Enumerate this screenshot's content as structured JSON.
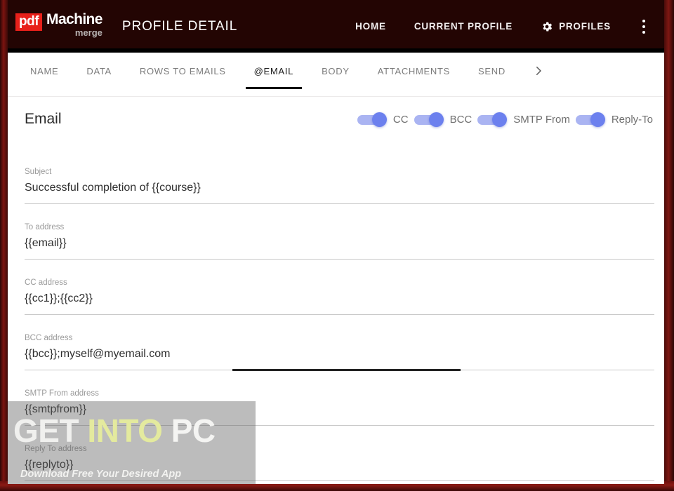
{
  "brand": {
    "logo_badge": "pdf",
    "logo_word": "Machine",
    "logo_sub": "merge",
    "accent_red": "#e8201a",
    "topbar_bg": "#230503"
  },
  "header": {
    "page_title": "PROFILE DETAIL",
    "nav": [
      {
        "label": "HOME",
        "icon": null
      },
      {
        "label": "CURRENT PROFILE",
        "icon": null
      },
      {
        "label": "PROFILES",
        "icon": "gear-icon"
      }
    ],
    "overflow_icon": "kebab-menu-icon"
  },
  "tabs": {
    "items": [
      {
        "label": "NAME",
        "active": false
      },
      {
        "label": "DATA",
        "active": false
      },
      {
        "label": "ROWS TO EMAILS",
        "active": false
      },
      {
        "label": "@EMAIL",
        "active": true
      },
      {
        "label": "BODY",
        "active": false
      },
      {
        "label": "ATTACHMENTS",
        "active": false
      },
      {
        "label": "SEND",
        "active": false
      }
    ],
    "more_icon": "chevron-right-icon"
  },
  "section": {
    "title": "Email",
    "toggles": [
      {
        "label": "CC",
        "on": true
      },
      {
        "label": "BCC",
        "on": true
      },
      {
        "label": "SMTP From",
        "on": true
      },
      {
        "label": "Reply-To",
        "on": true
      }
    ],
    "toggle_track_color": "#aab4f2",
    "toggle_knob_color": "#6c80ee"
  },
  "form": {
    "fields": [
      {
        "label": "Subject",
        "value": "Successful completion of {{course}}",
        "focused": false
      },
      {
        "label": "To address",
        "value": "{{email}}",
        "focused": false
      },
      {
        "label": "CC address",
        "value": "{{cc1}};{{cc2}}",
        "focused": false
      },
      {
        "label": "BCC address",
        "value": "{{bcc}};myself@myemail.com",
        "focused": true
      },
      {
        "label": "SMTP From address",
        "value": "{{smtpfrom}}",
        "focused": false
      },
      {
        "label": "Reply To address",
        "value": "{{replyto}}",
        "focused": false
      }
    ]
  },
  "watermark": {
    "part1": "GET",
    "part2": "INTO",
    "part3": "PC",
    "subtitle": "Download Free Your Desired App",
    "highlight_color": "#e4ea9e"
  }
}
